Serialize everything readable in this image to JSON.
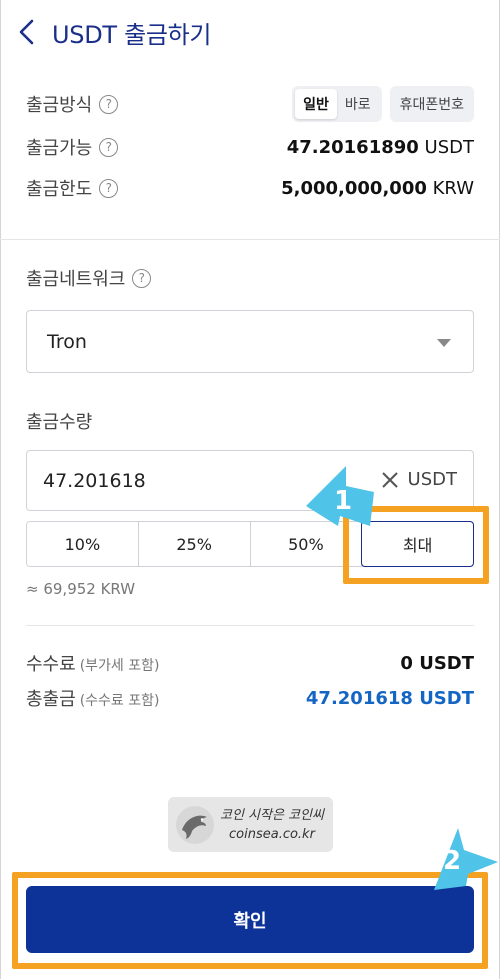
{
  "header": {
    "title": "USDT 출금하기"
  },
  "info": {
    "method_label": "출금방식",
    "method_options": [
      "일반",
      "바로"
    ],
    "method_phone": "휴대폰번호",
    "available_label": "출금가능",
    "available_amount": "47.20161890",
    "available_unit": "USDT",
    "limit_label": "출금한도",
    "limit_amount": "5,000,000,000",
    "limit_unit": "KRW"
  },
  "network": {
    "label": "출금네트워크",
    "selected": "Tron"
  },
  "amount": {
    "label": "출금수량",
    "value": "47.201618",
    "unit": "USDT",
    "percent_buttons": [
      "10%",
      "25%",
      "50%",
      "최대"
    ],
    "krw_estimate": "≈ 69,952 KRW"
  },
  "summary": {
    "fee_label": "수수료",
    "fee_note": "(부가세 포함)",
    "fee_value": "0 USDT",
    "total_label": "총출금",
    "total_note": "(수수료 포함)",
    "total_value": "47.201618 USDT"
  },
  "watermark": {
    "line1": "코인 시작은 코인씨",
    "line2": "coinsea.co.kr"
  },
  "confirm_label": "확인",
  "annotations": {
    "step1": "1",
    "step2": "2"
  },
  "colors": {
    "accent": "#1a2f8a",
    "button": "#0d3399",
    "highlight": "#f5a121",
    "arrow": "#4fc3e8",
    "total": "#1466c4"
  }
}
